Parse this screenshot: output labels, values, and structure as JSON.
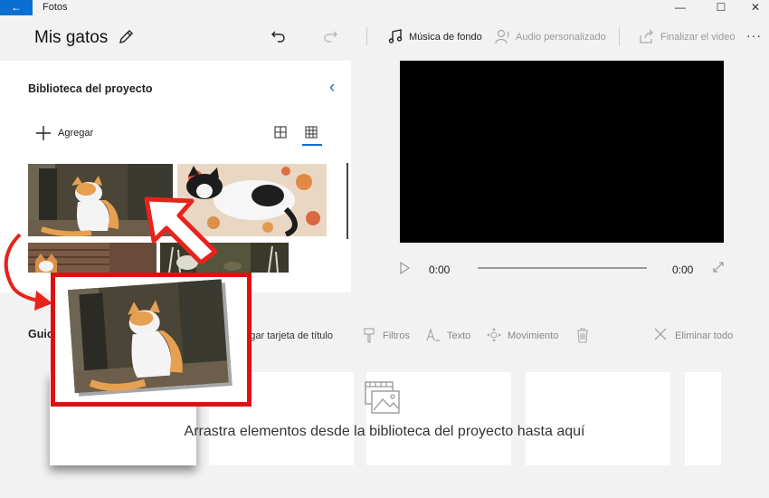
{
  "window": {
    "app_title": "Fotos",
    "back_glyph": "←",
    "minimize_glyph": "—",
    "maximize_glyph": "☐",
    "close_glyph": "✕"
  },
  "header": {
    "project_title": "Mis gatos",
    "background_music": "Música de fondo",
    "custom_audio": "Audio personalizado",
    "finish_video": "Finalizar el video",
    "more_glyph": "···"
  },
  "library": {
    "title": "Biblioteca del proyecto",
    "collapse_glyph": "‹",
    "add_label": "Agregar"
  },
  "player": {
    "time_current": "0:00",
    "time_total": "0:00",
    "progress": 0
  },
  "storyboard": {
    "title": "Guion gráfico",
    "add_title_card": "Agregar tarjeta de título",
    "filters": "Filtros",
    "text": "Texto",
    "motion": "Movimiento",
    "delete_all": "Eliminar todo",
    "drop_hint": "Arrastra elementos desde la biblioteca del proyecto hasta aquí"
  },
  "colors": {
    "accent": "#0a70d0",
    "highlight_red": "#e01010",
    "arrow_red": "#e8231c"
  }
}
